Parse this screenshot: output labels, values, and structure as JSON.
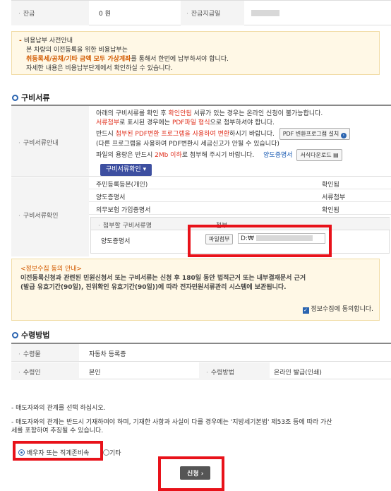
{
  "balance_row": {
    "balance_label": "잔금",
    "balance_value": "0 원",
    "payment_date_label": "잔금지급일"
  },
  "fee_notice": {
    "title": "비용납부 사전안내",
    "line1": "본 차량의 이전등록을 위한 비용납부는",
    "line2_highlight": "취등록세/공채/기타 금액 모두 가상계좌",
    "line2_rest": "를 통해서 한번에 납부하셔야 합니다.",
    "line3": "자세한 내용은 비용납부단계에서 확인하실 수 있습니다."
  },
  "documents_section": {
    "title": "구비서류",
    "guide_label": "구비서류안내",
    "guide_line1_a": "아래의 구비서류를 확인 후 ",
    "guide_line1_b": "확인안됨",
    "guide_line1_c": " 서류가 있는 경우는 온라인 신청이 불가능합니다.",
    "guide_line2_a": "서류첨부",
    "guide_line2_b": "로 표시된 경우에는 ",
    "guide_line2_c": "PDF파일 형식",
    "guide_line2_d": "으로 첨부하셔야 합니다.",
    "guide_line3_a": "반드시 ",
    "guide_line3_b": "첨부된 PDF변환 프로그램을 사용하여 변환",
    "guide_line3_c": "하시기 바랍니다.",
    "pdf_install_button": "PDF 변환프로그램 설치",
    "guide_line4": "(다른 프로그램을 사용하여 PDF변환시 세금신고가 안될 수 있습니다)",
    "guide_line5_a": "파일의 용량은 반드시 ",
    "guide_line5_b": "2Mb 이하",
    "guide_line5_c": "로 첨부해 주시기 바랍니다.",
    "transfer_cert_link": "양도증명서",
    "form_download_button": "서식다운로드",
    "check_docs_button": "구비서류확인",
    "confirm_label": "구비서류확인",
    "doc_rows": [
      {
        "name": "주민등록등본(개인)",
        "status": "확인됨"
      },
      {
        "name": "양도증명서",
        "status": "서류첨부"
      },
      {
        "name": "의무보험 가입증명서",
        "status": "확인됨"
      }
    ],
    "attach_header_doc": "첨부할 구비서류명",
    "attach_header_file": "첨부",
    "attach_doc_name": "양도증명서",
    "attach_button": "파일첨부",
    "attach_path": "D:₩"
  },
  "privacy_notice": {
    "title": "<정보수집 동의 안내>",
    "line1": "이전등록신청과 관련된 민원신청서 또는 구비서류는 신청 후 180일 동안 법적근거 또는 내부결재문서 근거",
    "line2": "(발급 유효기간(90일), 진위확인 유효기간(90일))에 따라 전자민원서류관리 시스템에 보관됩니다.",
    "agree_label": "정보수집에 동의합니다."
  },
  "receipt_section": {
    "title": "수령방법",
    "item_label": "수령물",
    "item_value": "자동차 등록증",
    "receiver_label": "수령인",
    "receiver_value": "본인",
    "method_label": "수령방법",
    "method_value": "온라인 발급(인쇄)"
  },
  "relation_section": {
    "instruction1": "- 매도자와의 관계를 선택 하십시오.",
    "instruction2_line1": "- 매도자와의 관계는 반드시 기재하여야 하며, 기재한 사항과 사실이 다를 경우에는 '지방세기본법' 제53조 등에 따라 가산",
    "instruction2_line2": "세를 포함하여 추징될 수 있습니다.",
    "option1": "배우자 또는 직계존비속",
    "option2": "기타",
    "submit_button": "신청"
  },
  "colors": {
    "accent_blue": "#2a64b0",
    "highlight_red": "#e0301e",
    "highlight_orange": "#d25a00",
    "annotation_red": "#e8121a"
  }
}
